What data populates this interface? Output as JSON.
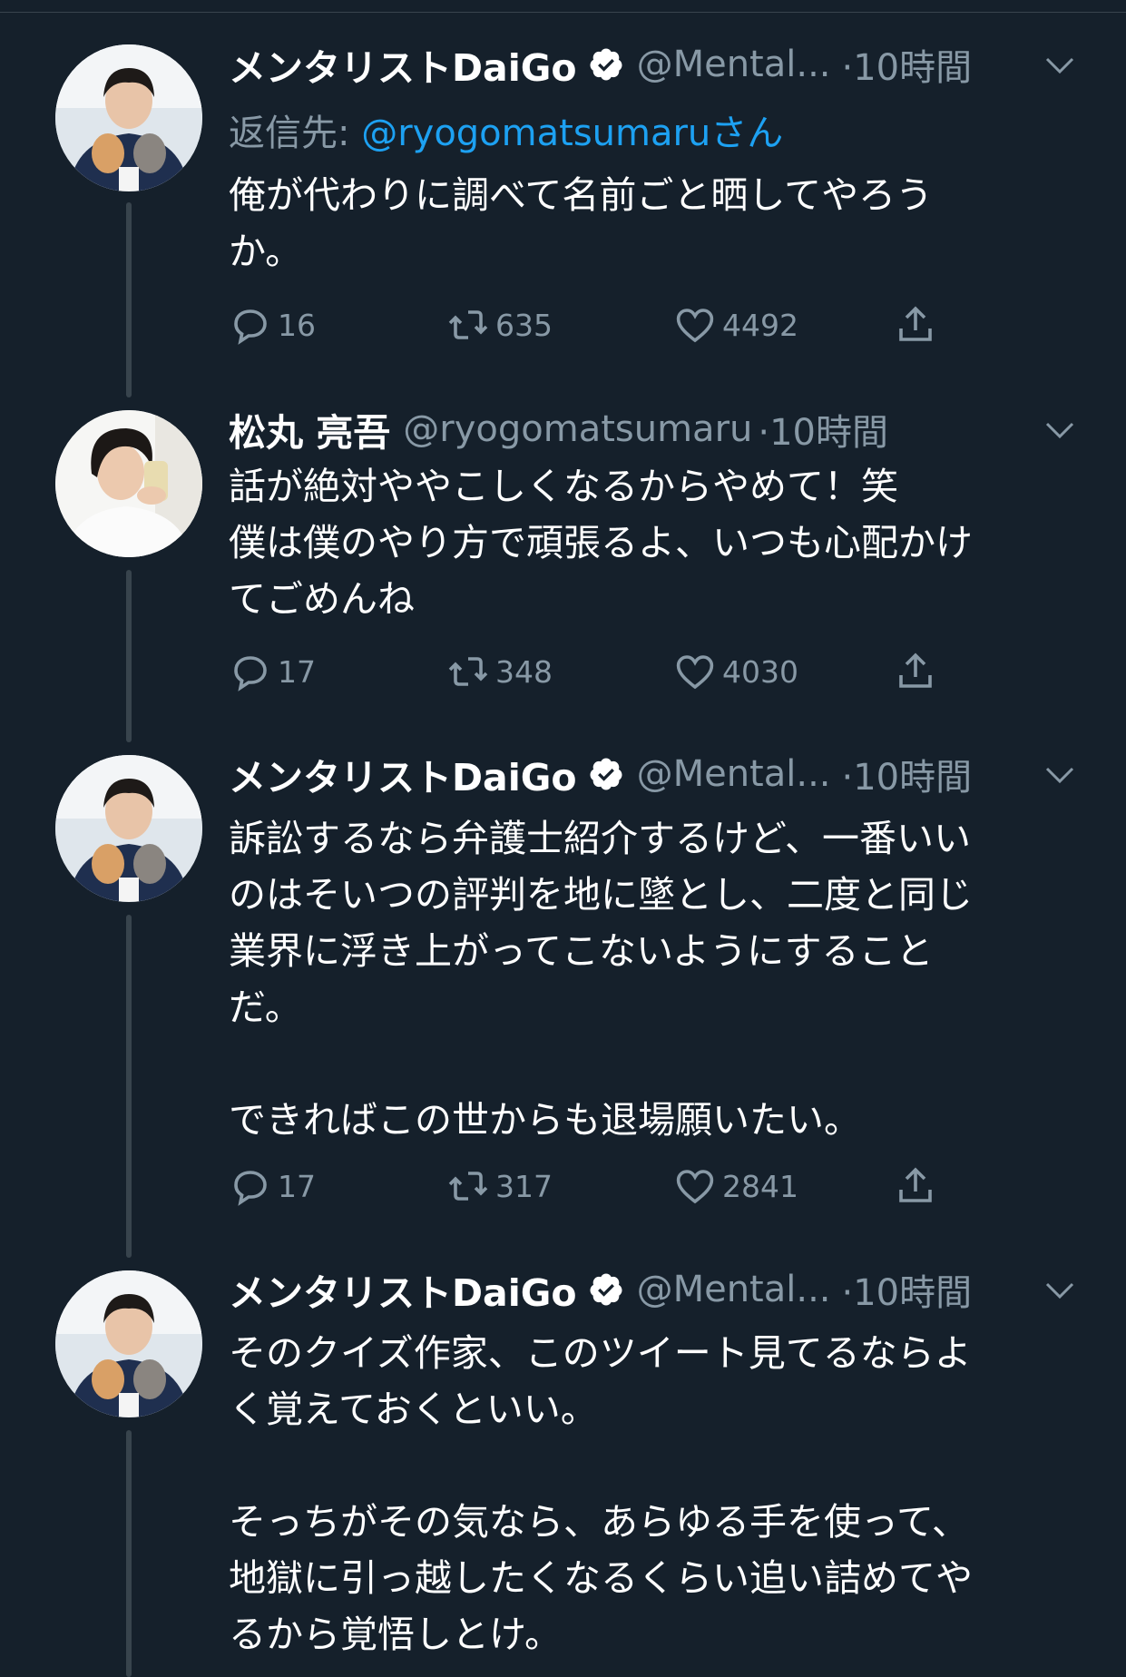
{
  "colors": {
    "background": "#15202b",
    "text": "#ffffff",
    "muted": "#8899a6",
    "link": "#1da1f2",
    "thread_line": "#38444d"
  },
  "tweets": [
    {
      "name": "メンタリストDaiGo",
      "verified": true,
      "handle": "@Mental...",
      "time": "·10時間",
      "reply_label": "返信先:",
      "reply_mention": "@ryogomatsumaruさん",
      "text": "俺が代わりに調べて名前ごと晒してやろう\nか。",
      "replies": "16",
      "retweets": "635",
      "likes": "4492"
    },
    {
      "name": "松丸 亮吾",
      "verified": false,
      "handle": "@ryogomatsumaru",
      "time": "·10時間",
      "text": "話が絶対ややこしくなるからやめて！笑\n僕は僕のやり方で頑張るよ、いつも心配かけ\nてごめんね",
      "replies": "17",
      "retweets": "348",
      "likes": "4030"
    },
    {
      "name": "メンタリストDaiGo",
      "verified": true,
      "handle": "@Mental...",
      "time": "·10時間",
      "text": "訴訟するなら弁護士紹介するけど、一番いい\nのはそいつの評判を地に墜とし、二度と同じ\n業界に浮き上がってこないようにすること\nだ。\n\nできればこの世からも退場願いたい。",
      "replies": "17",
      "retweets": "317",
      "likes": "2841"
    },
    {
      "name": "メンタリストDaiGo",
      "verified": true,
      "handle": "@Mental...",
      "time": "·10時間",
      "text": "そのクイズ作家、このツイート見てるならよ\nく覚えておくといい。\n\nそっちがその気なら、あらゆる手を使って、\n地獄に引っ越したくなるくらい追い詰めてや\nるから覚悟しとけ。"
    }
  ]
}
